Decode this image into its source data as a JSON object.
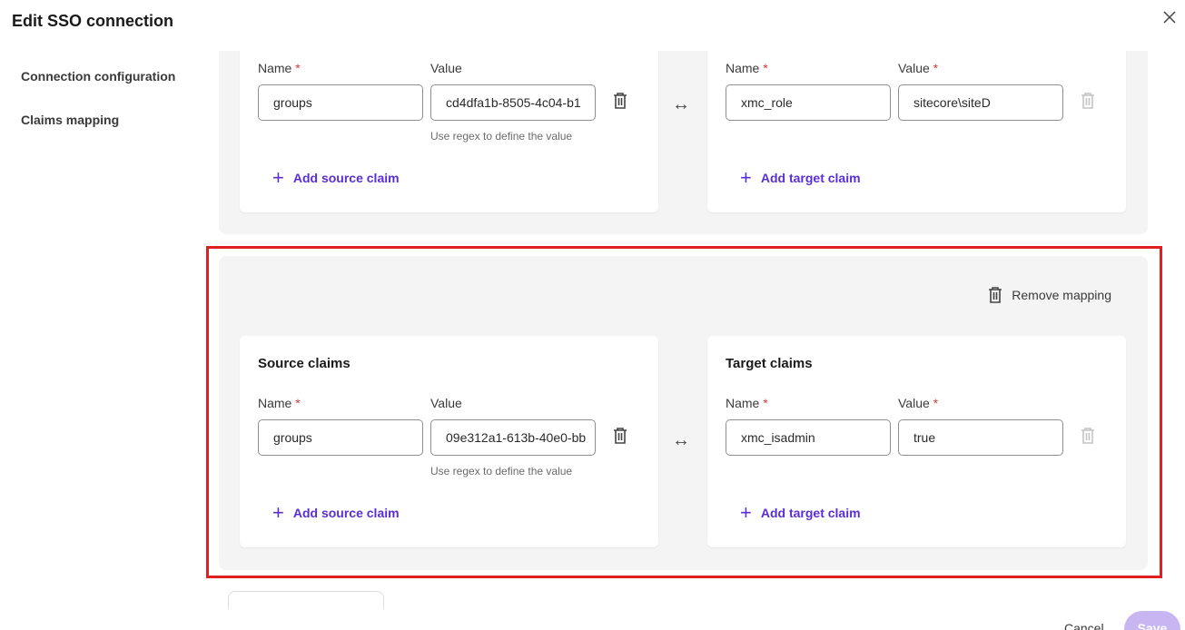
{
  "dialog": {
    "title": "Edit SSO connection"
  },
  "nav": {
    "items": [
      {
        "label": "Connection configuration"
      },
      {
        "label": "Claims mapping"
      }
    ]
  },
  "labels": {
    "name": "Name",
    "value": "Value",
    "required_mark": "*",
    "regex_hint": "Use regex to define the value",
    "add_source_claim": "Add source claim",
    "add_target_claim": "Add target claim",
    "source_claims": "Source claims",
    "target_claims": "Target claims",
    "remove_mapping": "Remove mapping",
    "mapping_arrow": "↔"
  },
  "mappings": [
    {
      "source": {
        "name": "groups",
        "value": "cd4dfa1b-8505-4c04-b1"
      },
      "target": {
        "name": "xmc_role",
        "value": "sitecore\\siteD"
      }
    },
    {
      "source": {
        "name": "groups",
        "value": "09e312a1-613b-40e0-bb"
      },
      "target": {
        "name": "xmc_isadmin",
        "value": "true"
      }
    }
  ],
  "footer": {
    "cancel_label": "Cancel",
    "save_label": "Save"
  },
  "colors": {
    "accent": "#5a2fd1",
    "required": "#d63b3b",
    "highlight": "#e02020",
    "save_disabled": "#c8b6f3"
  },
  "icons": {
    "close": "close-icon",
    "trash": "trash-icon",
    "plus": "plus-icon",
    "arrows": "left-right-arrow-icon"
  }
}
